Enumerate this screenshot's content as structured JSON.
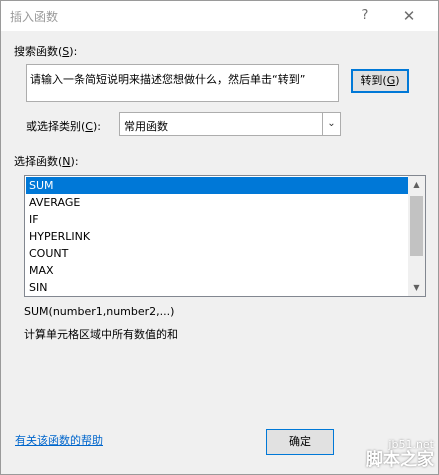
{
  "window": {
    "title": "插入函数",
    "help_glyph": "?",
    "close_glyph": "✕"
  },
  "search": {
    "label_prefix": "搜索函数(",
    "label_key": "S",
    "label_suffix": "):",
    "placeholder": "请输入一条简短说明来描述您想做什么，然后单击“转到”",
    "goto_prefix": "转到(",
    "goto_key": "G",
    "goto_suffix": ")"
  },
  "category": {
    "label_prefix": "或选择类别(",
    "label_key": "C",
    "label_suffix": "):",
    "selected": "常用函数"
  },
  "functions": {
    "label_prefix": "选择函数(",
    "label_key": "N",
    "label_suffix": "):",
    "items": [
      "SUM",
      "AVERAGE",
      "IF",
      "HYPERLINK",
      "COUNT",
      "MAX",
      "SIN"
    ],
    "selected_index": 0
  },
  "description": {
    "syntax": "SUM(number1,number2,...)",
    "text": "计算单元格区域中所有数值的和"
  },
  "footer": {
    "help_link": "有关该函数的帮助",
    "ok_label": "确定"
  },
  "watermark": {
    "url": "jb51.net",
    "name": "脚本之家"
  }
}
